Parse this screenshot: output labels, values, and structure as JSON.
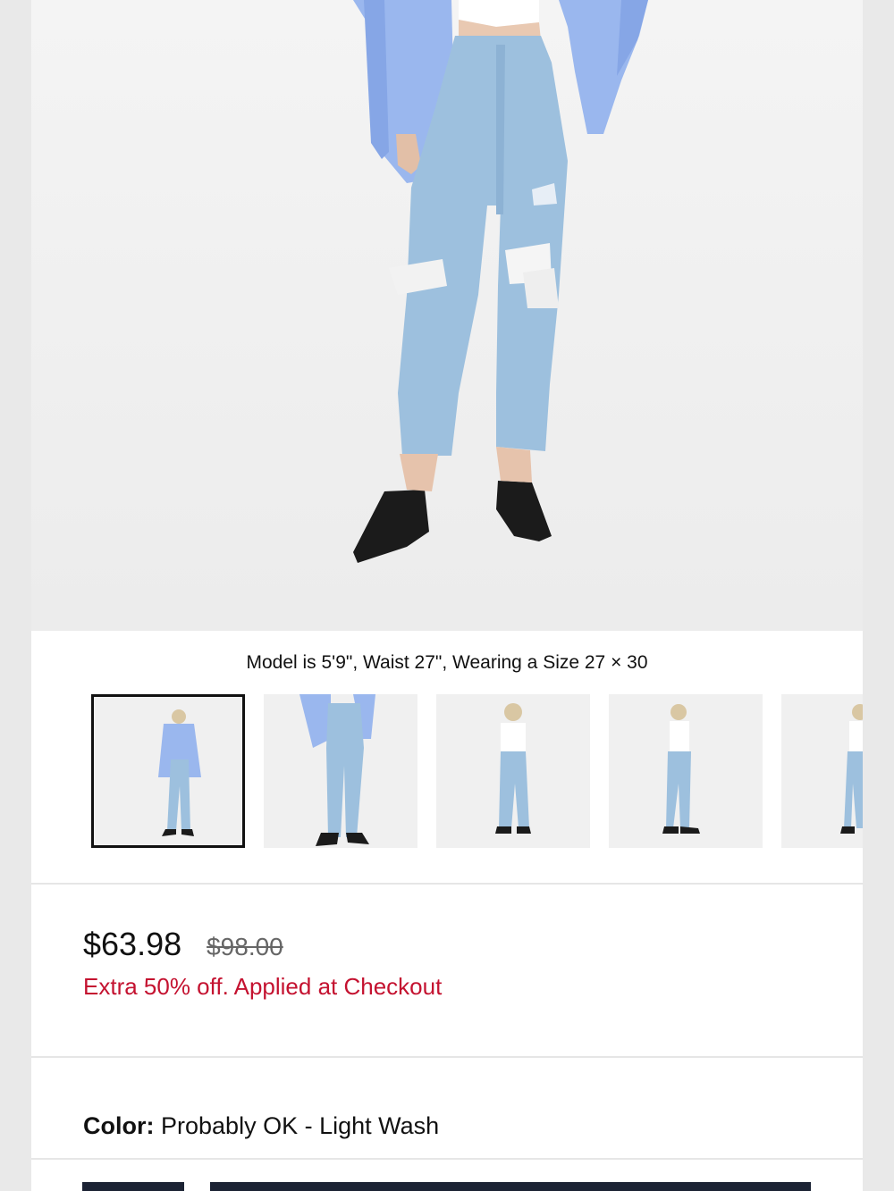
{
  "hero": {
    "image_icon": "model-wearing-jeans-image"
  },
  "model_caption": "Model is 5'9\", Waist 27\", Wearing a Size 27 × 30",
  "thumbnails": [
    {
      "label": "front-full",
      "active": true
    },
    {
      "label": "front-detail",
      "active": false
    },
    {
      "label": "back-full",
      "active": false
    },
    {
      "label": "side-full",
      "active": false
    },
    {
      "label": "back-partial",
      "active": false
    }
  ],
  "pricing": {
    "current": "$63.98",
    "original": "$98.00",
    "promo": "Extra 50% off. Applied at Checkout"
  },
  "color": {
    "label": "Color:",
    "value": "Probably OK - Light Wash"
  },
  "colors": {
    "promo_red": "#c41230",
    "denim": "#9dc0de",
    "shirt_blue": "#9ab7ee"
  }
}
